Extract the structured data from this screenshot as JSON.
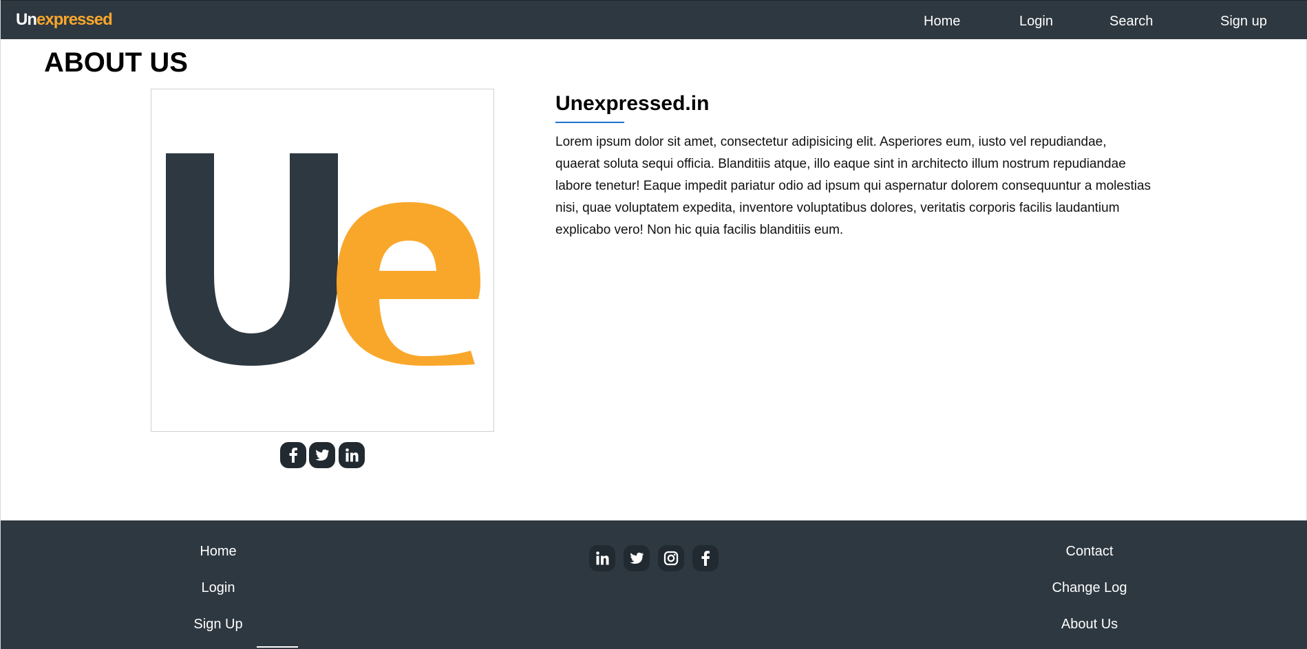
{
  "navbar": {
    "brand_part1": "Un",
    "brand_part2": "expressed",
    "links": [
      "Home",
      "Login",
      "Search",
      "Sign up"
    ]
  },
  "about": {
    "title": "ABOUT US",
    "logo_letters": [
      "U",
      "e"
    ],
    "site_name": "Unexpressed.in",
    "description": "Lorem ipsum dolor sit amet, consectetur adipisicing elit. Asperiores eum, iusto vel repudiandae, quaerat soluta sequi officia. Blanditiis atque, illo eaque sint in architecto illum nostrum repudiandae labore tenetur! Eaque impedit pariatur odio ad ipsum qui aspernatur dolorem consequuntur a molestias nisi, quae voluptatem expedita, inventore voluptatibus dolores, veritatis corporis facilis laudantium explicabo vero! Non hic quia facilis blanditiis eum.",
    "social_icons": [
      "facebook-icon",
      "twitter-icon",
      "linkedin-icon"
    ]
  },
  "footer": {
    "left_links": [
      "Home",
      "Login",
      "Sign Up"
    ],
    "right_links": [
      "Contact",
      "Change Log",
      "About Us"
    ],
    "social_icons": [
      "linkedin-icon",
      "twitter-icon",
      "instagram-icon",
      "facebook-icon"
    ]
  },
  "colors": {
    "navbar_bg": "#2e3840",
    "accent_orange": "#f9a72b",
    "logo_dark": "#2e3840",
    "underline_blue": "#1a73c8"
  }
}
